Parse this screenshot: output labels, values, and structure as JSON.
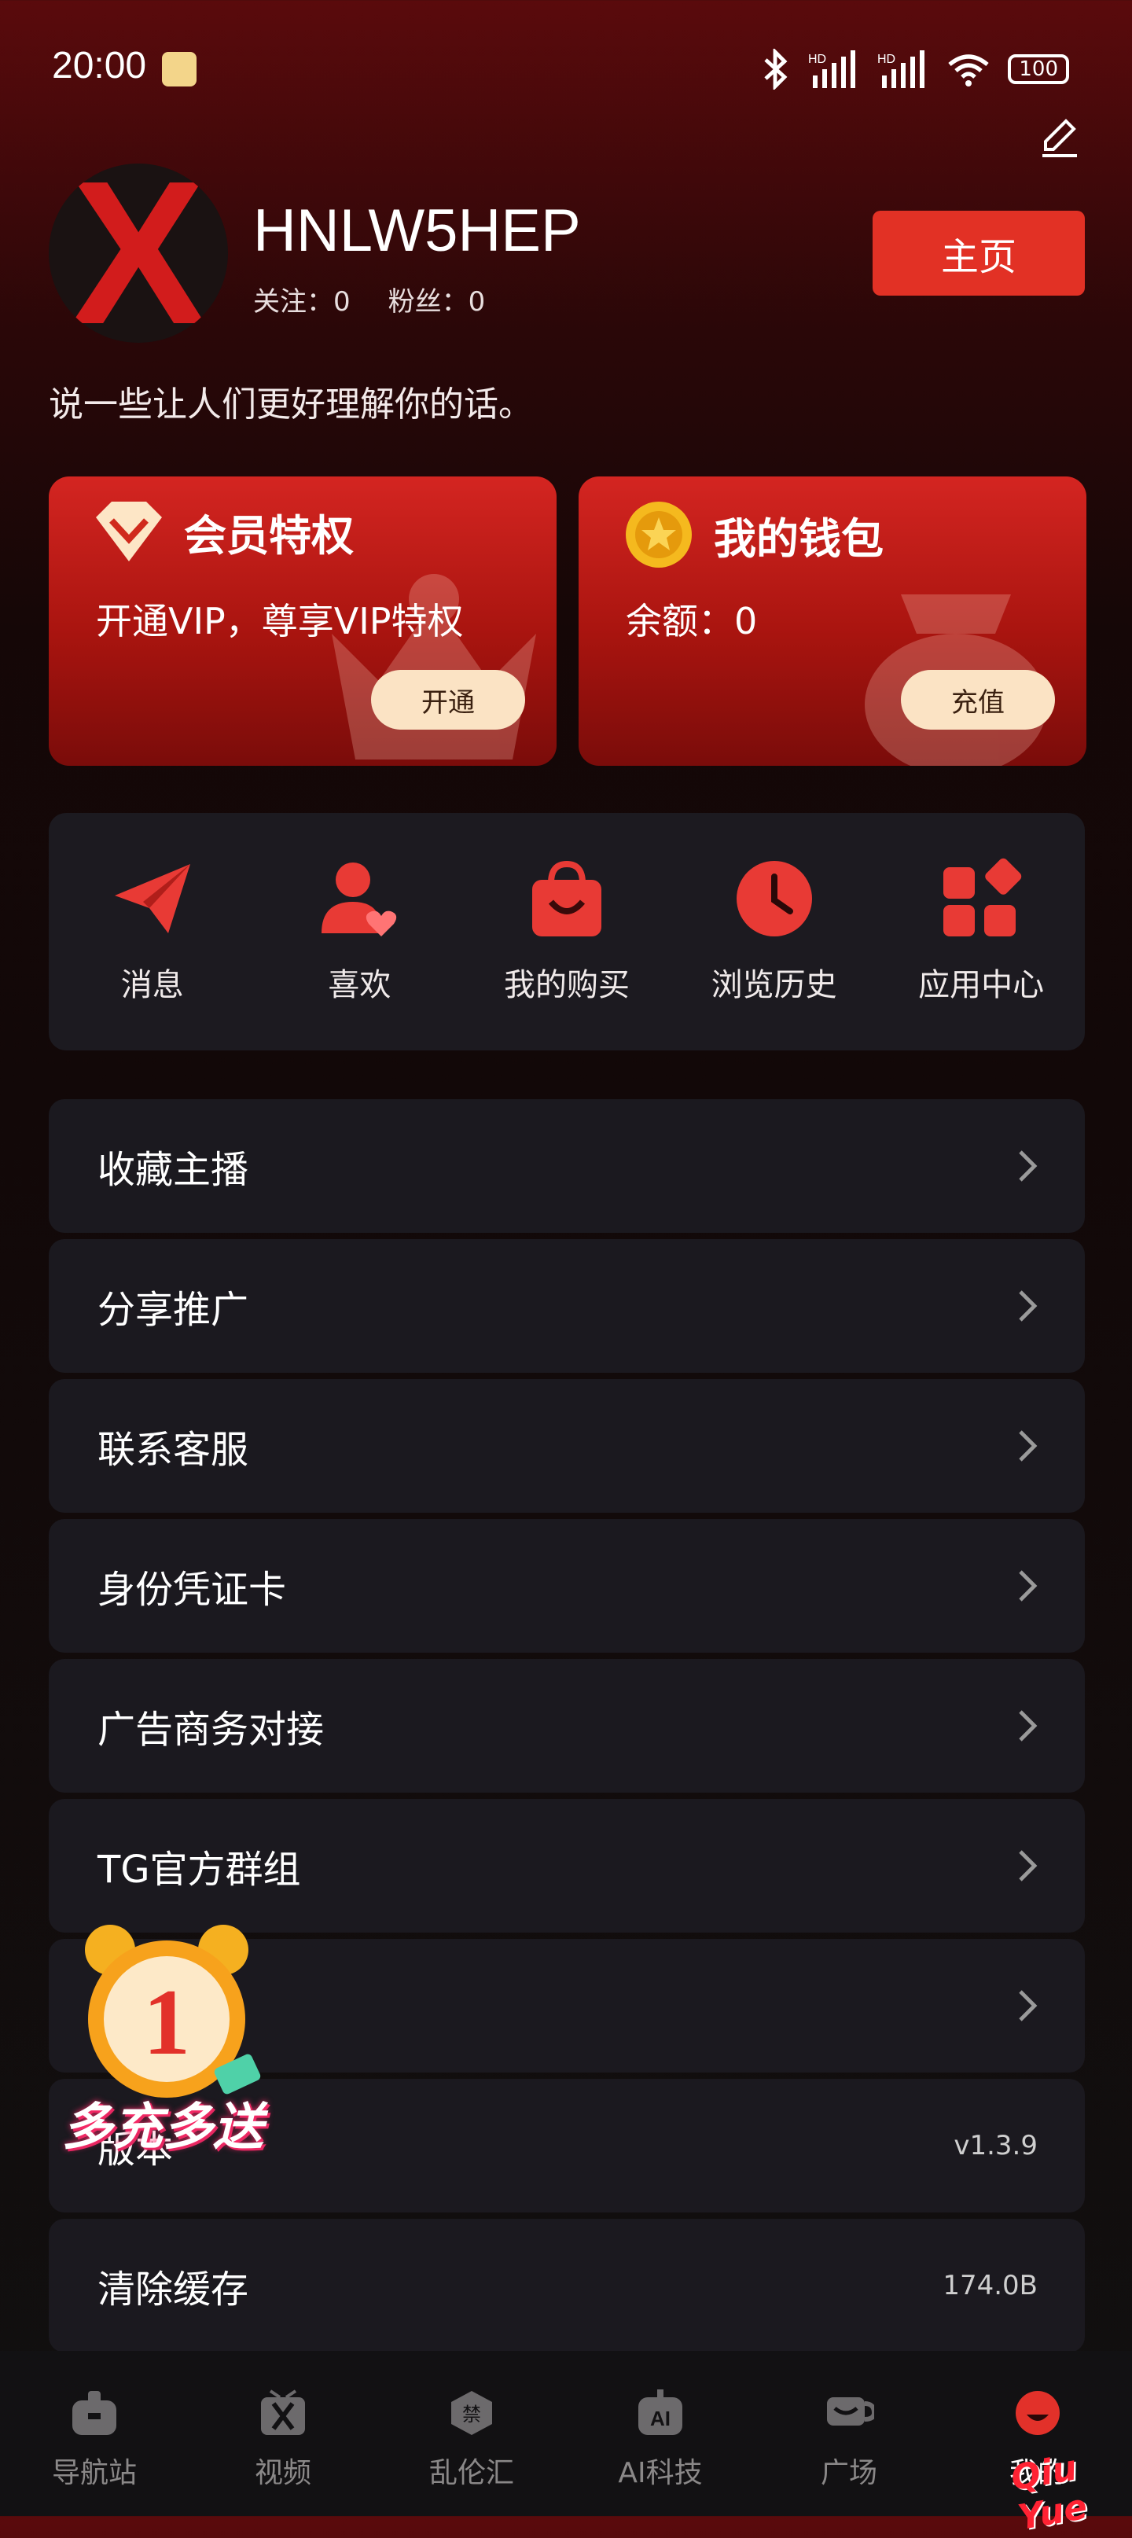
{
  "status_bar": {
    "time": "20:00",
    "battery": "100",
    "signal1": "HD",
    "signal2": "HD"
  },
  "profile": {
    "avatar_letter": "X",
    "username": "HNLW5HEP",
    "follow_label": "关注：0",
    "fans_label": "粉丝：0",
    "home_button": "主页",
    "bio": "说一些让人们更好理解你的话。"
  },
  "cards": {
    "vip": {
      "title": "会员特权",
      "subtitle": "开通VIP，尊享VIP特权",
      "button": "开通"
    },
    "wallet": {
      "title": "我的钱包",
      "subtitle": "余额：0",
      "button": "充值"
    }
  },
  "quick_menu": [
    {
      "label": "消息",
      "icon": "paper-plane-icon"
    },
    {
      "label": "喜欢",
      "icon": "user-heart-icon"
    },
    {
      "label": "我的购买",
      "icon": "shopping-bag-icon"
    },
    {
      "label": "浏览历史",
      "icon": "clock-icon"
    },
    {
      "label": "应用中心",
      "icon": "app-grid-icon"
    }
  ],
  "menu_list": [
    {
      "label": "收藏主播",
      "value": ""
    },
    {
      "label": "分享推广",
      "value": ""
    },
    {
      "label": "联系客服",
      "value": ""
    },
    {
      "label": "身份凭证卡",
      "value": ""
    },
    {
      "label": "广告商务对接",
      "value": ""
    },
    {
      "label": "TG官方群组",
      "value": ""
    },
    {
      "label": "",
      "value": ""
    },
    {
      "label": "版本",
      "value": "v1.3.9"
    },
    {
      "label": "清除缓存",
      "value": "174.0B"
    }
  ],
  "promo": {
    "number": "1",
    "text": "多充多送"
  },
  "bottom_nav": [
    {
      "label": "导航站",
      "icon": "home-icon"
    },
    {
      "label": "视频",
      "icon": "video-icon"
    },
    {
      "label": "乱伦汇",
      "icon": "forbidden-badge-icon"
    },
    {
      "label": "AI科技",
      "icon": "ai-icon"
    },
    {
      "label": "广场",
      "icon": "cup-icon"
    },
    {
      "label": "我的",
      "icon": "profile-icon"
    }
  ],
  "watermark": "Qiu Yue",
  "colors": {
    "accent": "#e23125",
    "card_button": "#fbe3c4",
    "panel": "#1b191f"
  }
}
